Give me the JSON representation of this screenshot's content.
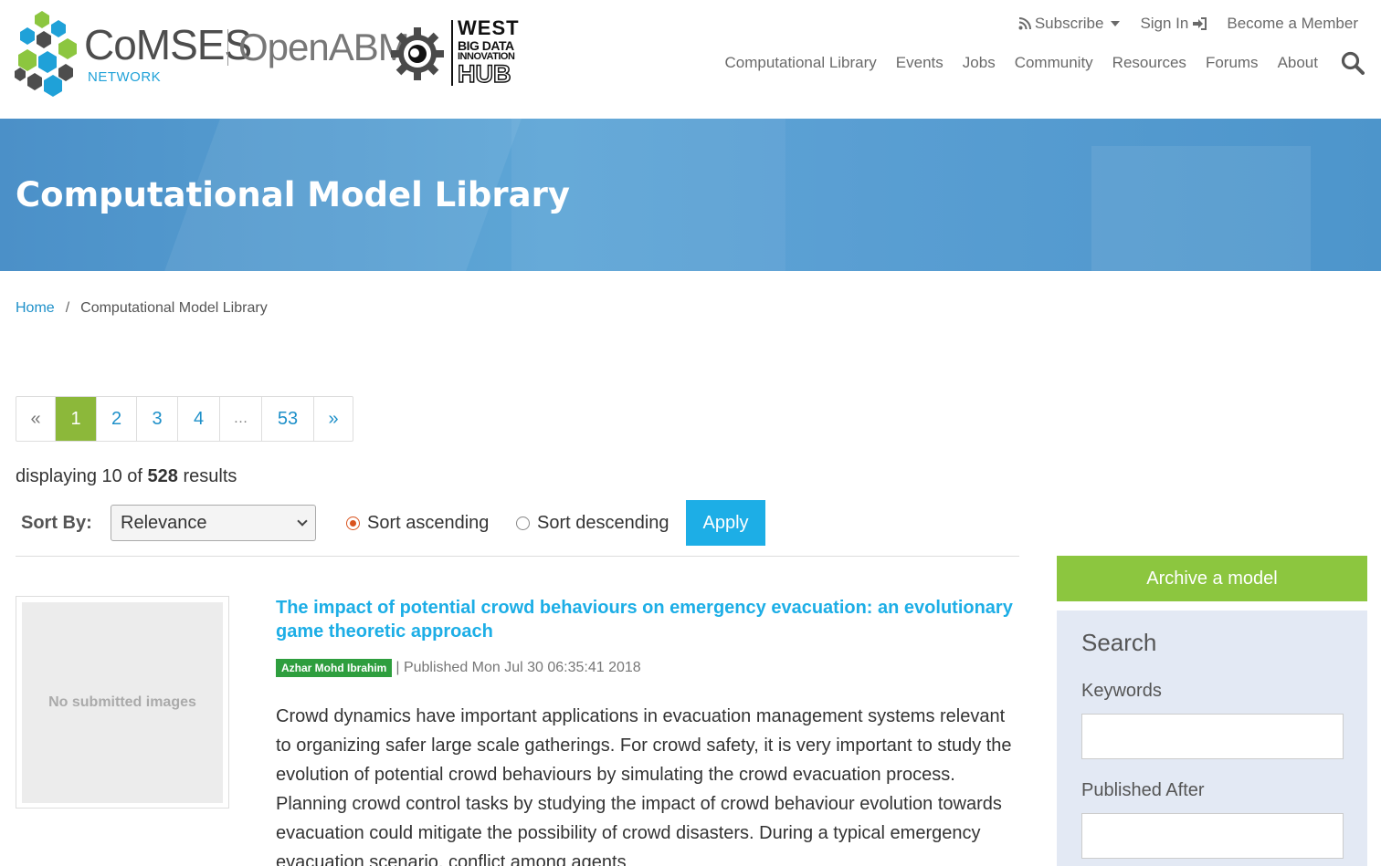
{
  "brand": {
    "comses_word": "CoMSES",
    "comses_sub": "NETWORK",
    "openabm": "OpenABM",
    "west_line1": "WEST",
    "west_line2": "BIG DATA",
    "west_line3": "INNOVATION",
    "west_line4": "HUB"
  },
  "top_links": {
    "subscribe": "Subscribe",
    "sign_in": "Sign In",
    "become_member": "Become a Member"
  },
  "nav": {
    "items": [
      "Computational Library",
      "Events",
      "Jobs",
      "Community",
      "Resources",
      "Forums",
      "About"
    ]
  },
  "banner": {
    "title": "Computational Model Library"
  },
  "breadcrumb": {
    "home": "Home",
    "separator": "/",
    "current": "Computational Model Library"
  },
  "pagination": {
    "prev": "«",
    "pages": [
      "1",
      "2",
      "3",
      "4",
      "…",
      "53"
    ],
    "next": "»",
    "active": "1"
  },
  "results": {
    "prefix": "displaying 10 of",
    "total": "528",
    "suffix": "results"
  },
  "sort": {
    "label": "Sort By:",
    "selected": "Relevance",
    "ascending": "Sort ascending",
    "descending": "Sort descending",
    "apply": "Apply"
  },
  "result": {
    "no_image": "No submitted images",
    "title": "The impact of potential crowd behaviours on emergency evacuation: an evolutionary game theoretic approach",
    "author": "Azhar Mohd Ibrahim",
    "published": "| Published Mon Jul 30 06:35:41 2018",
    "description": "Crowd dynamics have important applications in evacuation management systems relevant to organizing safer large scale gatherings. For crowd safety, it is very important to study the evolution of potential crowd behaviours by simulating the crowd evacuation process. Planning crowd control tasks by studying the impact of crowd behaviour evolution towards evacuation could mitigate the possibility of crowd disasters. During a typical emergency evacuation scenario, conflict among agents"
  },
  "sidebar": {
    "archive": "Archive a model",
    "search_title": "Search",
    "keywords_label": "Keywords",
    "published_after_label": "Published After"
  },
  "colors": {
    "accent_blue": "#1daee6",
    "accent_green": "#8cb83a",
    "author_green": "#2e9e3e",
    "radio_orange": "#d9531e"
  }
}
